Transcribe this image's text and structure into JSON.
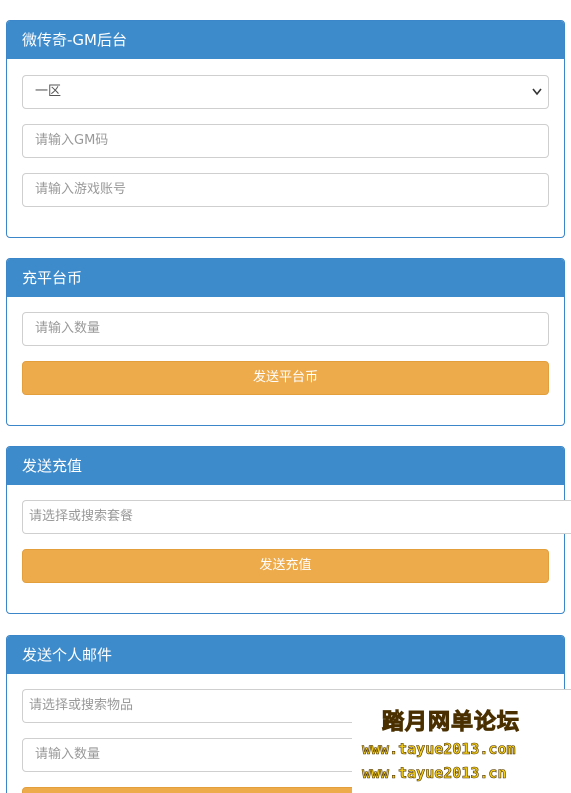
{
  "panels": {
    "gm": {
      "title": "微传奇-GM后台",
      "server_select": "一区",
      "gm_code_placeholder": "请输入GM码",
      "account_placeholder": "请输入游戏账号"
    },
    "platform_coin": {
      "title": "充平台币",
      "amount_placeholder": "请输入数量",
      "send_button": "发送平台币"
    },
    "recharge": {
      "title": "发送充值",
      "package_placeholder": "请选择或搜索套餐",
      "send_button": "发送充值"
    },
    "mail": {
      "title": "发送个人邮件",
      "item_placeholder": "请选择或搜索物品",
      "amount_placeholder": "请输入数量"
    }
  },
  "watermark": {
    "title": "踏月网单论坛",
    "url1": "www.tayue2013.com",
    "url2": "www.tayue2013.cn"
  },
  "colors": {
    "header_blue": "#3e8bcc",
    "button_orange": "#eeab4c",
    "watermark_yellow": "#f6d01c"
  }
}
